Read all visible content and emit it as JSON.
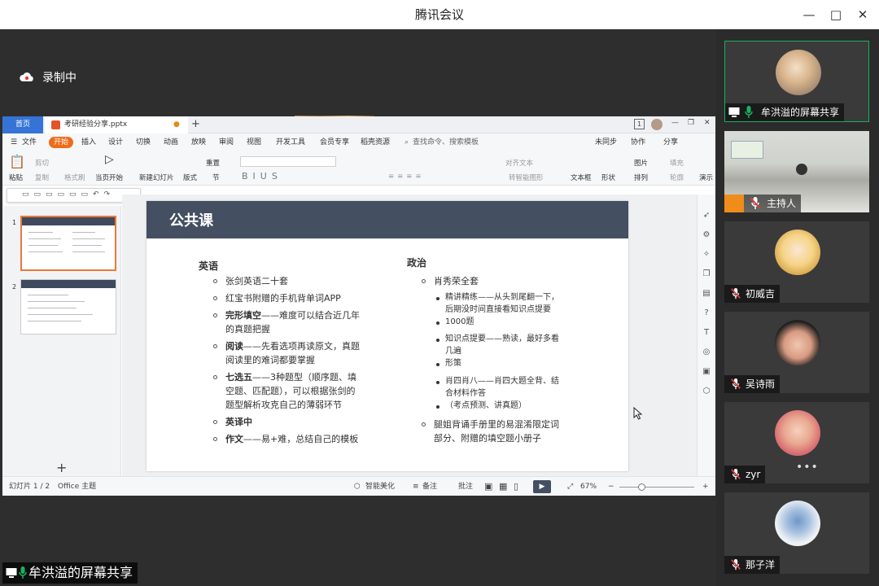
{
  "window": {
    "title": "腾讯会议",
    "controls": [
      "—",
      "□",
      "✕"
    ]
  },
  "recording": {
    "label": "录制中"
  },
  "presenter_label": "牟洪溢的屏幕共享",
  "wps": {
    "tabs": {
      "home": "首页",
      "doc": "考研经验分享.pptx"
    },
    "menus": [
      "文件",
      "开始",
      "插入",
      "设计",
      "切换",
      "动画",
      "放映",
      "审阅",
      "视图",
      "开发工具",
      "会员专享",
      "稻壳资源"
    ],
    "search": "查找命令、搜索模板",
    "right_menu": [
      "未同步",
      "协作",
      "分享"
    ],
    "ribbon": {
      "paste": "粘贴",
      "cut": "剪切",
      "copy": "复制",
      "format_painter": "格式刷",
      "from_start": "当页开始",
      "new_slide": "新建幻灯片",
      "layout": "版式",
      "section": "节",
      "reset": "重置",
      "align_text": "对齐文本",
      "smart_graphic": "转智能图形",
      "textbox": "文本框",
      "shape": "形状",
      "arrange": "排列",
      "picture": "图片",
      "fill": "填充",
      "outline": "轮廓",
      "play": "演示"
    },
    "slide": {
      "title": "公共课",
      "english_heading": "英语",
      "english_items": [
        {
          "bold": "",
          "rest": "张剑英语二十套"
        },
        {
          "bold": "",
          "rest": "红宝书附赠的手机背单词APP"
        },
        {
          "bold": "完形填空",
          "rest": "——难度可以结合近几年",
          "rest2": "的真题把握"
        },
        {
          "bold": "阅读",
          "rest": "——先看选项再读原文，真题",
          "rest2": "阅读里的难词都要掌握"
        },
        {
          "bold": "七选五",
          "rest": "——3种题型（顺序题、填",
          "rest2": "空题、匹配题），可以根据张剑的",
          "rest3": "题型解析攻克自己的薄弱环节"
        },
        {
          "bold": "英译中",
          "rest": ""
        },
        {
          "bold": "作文",
          "rest": "——易+难，总结自己的模板"
        }
      ],
      "politics_heading": "政治",
      "politics_top": "肖秀荣全套",
      "politics_sub": [
        "精讲精练——从头到尾翻一下，",
        "后期没时间直接看知识点提要",
        "1000题",
        "知识点提要——熟读，最好多看",
        "几遍",
        "形策",
        "肖四肖八——肖四大题全背、结",
        "合材料作答",
        "（考点预测、讲真题）"
      ],
      "politics_last": [
        "腿姐背诵手册里的易混淆限定词",
        "部分、附赠的填空题小册子"
      ]
    },
    "thumb_numbers": [
      "1",
      "2"
    ],
    "add": "+",
    "status": {
      "slide": "幻灯片 1 / 2",
      "theme": "Office 主题",
      "beautify": "智能美化",
      "notes": "备注",
      "comment": "批注",
      "zoom": "67%"
    }
  },
  "participants": [
    {
      "name": "牟洪溢的屏幕共享",
      "avatar": "photo-plush",
      "mic": "on"
    },
    {
      "name": "主持人",
      "avatar": "video-office",
      "mic": "off"
    },
    {
      "name": "初威吉",
      "avatar": "anime-girl",
      "mic": "off"
    },
    {
      "name": "吴诗雨",
      "avatar": "sunglasses-girl",
      "mic": "off"
    },
    {
      "name": "zyr",
      "avatar": "photo-girl",
      "mic": "off"
    },
    {
      "name": "那子洋",
      "avatar": "blue-flower",
      "mic": "off"
    }
  ],
  "more": "•••",
  "colors": {
    "accent": "#18b05e",
    "mic_off": "#e03b3b",
    "wps_orange": "#ef6c1a",
    "slide_header": "#444f62"
  }
}
